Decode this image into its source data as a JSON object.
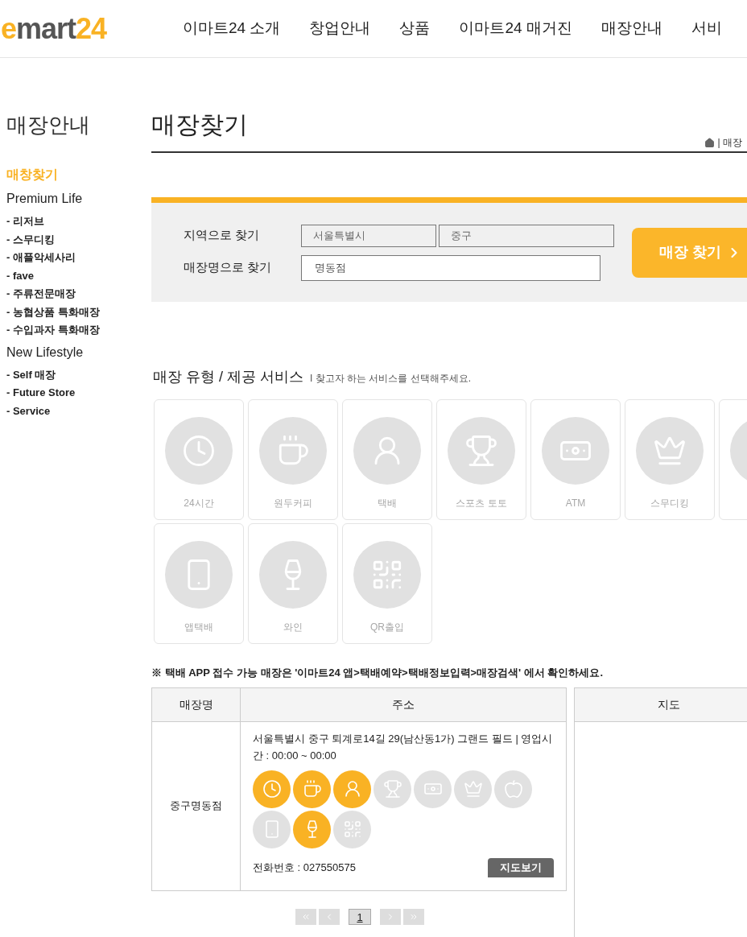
{
  "header": {
    "logo": {
      "first": "e",
      "rest": "mart",
      "number": "24"
    },
    "nav": [
      "이마트24 소개",
      "창업안내",
      "상품",
      "이마트24 매거진",
      "매장안내",
      "서비"
    ]
  },
  "sidebar": {
    "title": "매장안내",
    "items": [
      {
        "label": "매창찾기",
        "selected": true
      },
      {
        "label": "Premium Life",
        "selected": false,
        "children": [
          {
            "label": "- 리저브"
          },
          {
            "label": "- 스무디킹"
          },
          {
            "label": "- 애플악세사리"
          },
          {
            "label": "- fave"
          },
          {
            "label": "- 주류전문매장"
          },
          {
            "label": "- 농협상품 특화매장"
          },
          {
            "label": "- 수입과자 특화매장"
          }
        ]
      },
      {
        "label": "New Lifestyle",
        "selected": false,
        "children": [
          {
            "label": "- Self 매장"
          },
          {
            "label": "- Future Store"
          },
          {
            "label": "- Service"
          }
        ]
      }
    ]
  },
  "page_title": "매장찾기",
  "breadcrumb": "| 매장",
  "search": {
    "region_label": "지역으로 찾기",
    "city": "서울특별시",
    "district": "중구",
    "name_label": "매장명으로 찾기",
    "name_value": "명동점",
    "button": "매장 찾기"
  },
  "services": {
    "title": "매장 유형 / 제공 서비스",
    "hint": "I 찾고자 하는 서비스를 선택해주세요.",
    "tiles": [
      {
        "label": "24시간",
        "selected": false
      },
      {
        "label": "원두커피",
        "selected": false
      },
      {
        "label": "택배",
        "selected": false
      },
      {
        "label": "스포츠 토토",
        "selected": false
      },
      {
        "label": "ATM",
        "selected": false
      },
      {
        "label": "스무디킹",
        "selected": false
      },
      {
        "selected": false
      },
      {
        "label": "앱택배",
        "selected": false
      },
      {
        "label": "와인",
        "selected": false
      },
      {
        "label": "QR출입",
        "selected": false
      }
    ]
  },
  "notice": "※ 택배 APP 접수 가능 매장은 '이마트24 앱>택배예약>택배정보입력>매장검색' 에서 확인하세요.",
  "table": {
    "columns": [
      "매장명",
      "주소",
      "지도"
    ],
    "rows": [
      {
        "name": "중구명동점",
        "address": "서울특별시 중구 퇴계로14길 29(남산동1가) 그랜드 필드 | 영업시간 : 00:00 ~ 00:00",
        "services": [
          {
            "on": true
          },
          {
            "on": true
          },
          {
            "on": true
          },
          {
            "on": false
          },
          {
            "on": false
          },
          {
            "on": false
          },
          {
            "on": false
          },
          {
            "on": false
          },
          {
            "on": true
          },
          {
            "on": false
          }
        ],
        "phone": "전화번호 : 027550575",
        "map_button": "지도보기"
      }
    ]
  },
  "pagination": {
    "pages": [
      {
        "label": "1",
        "selected": true
      }
    ]
  }
}
